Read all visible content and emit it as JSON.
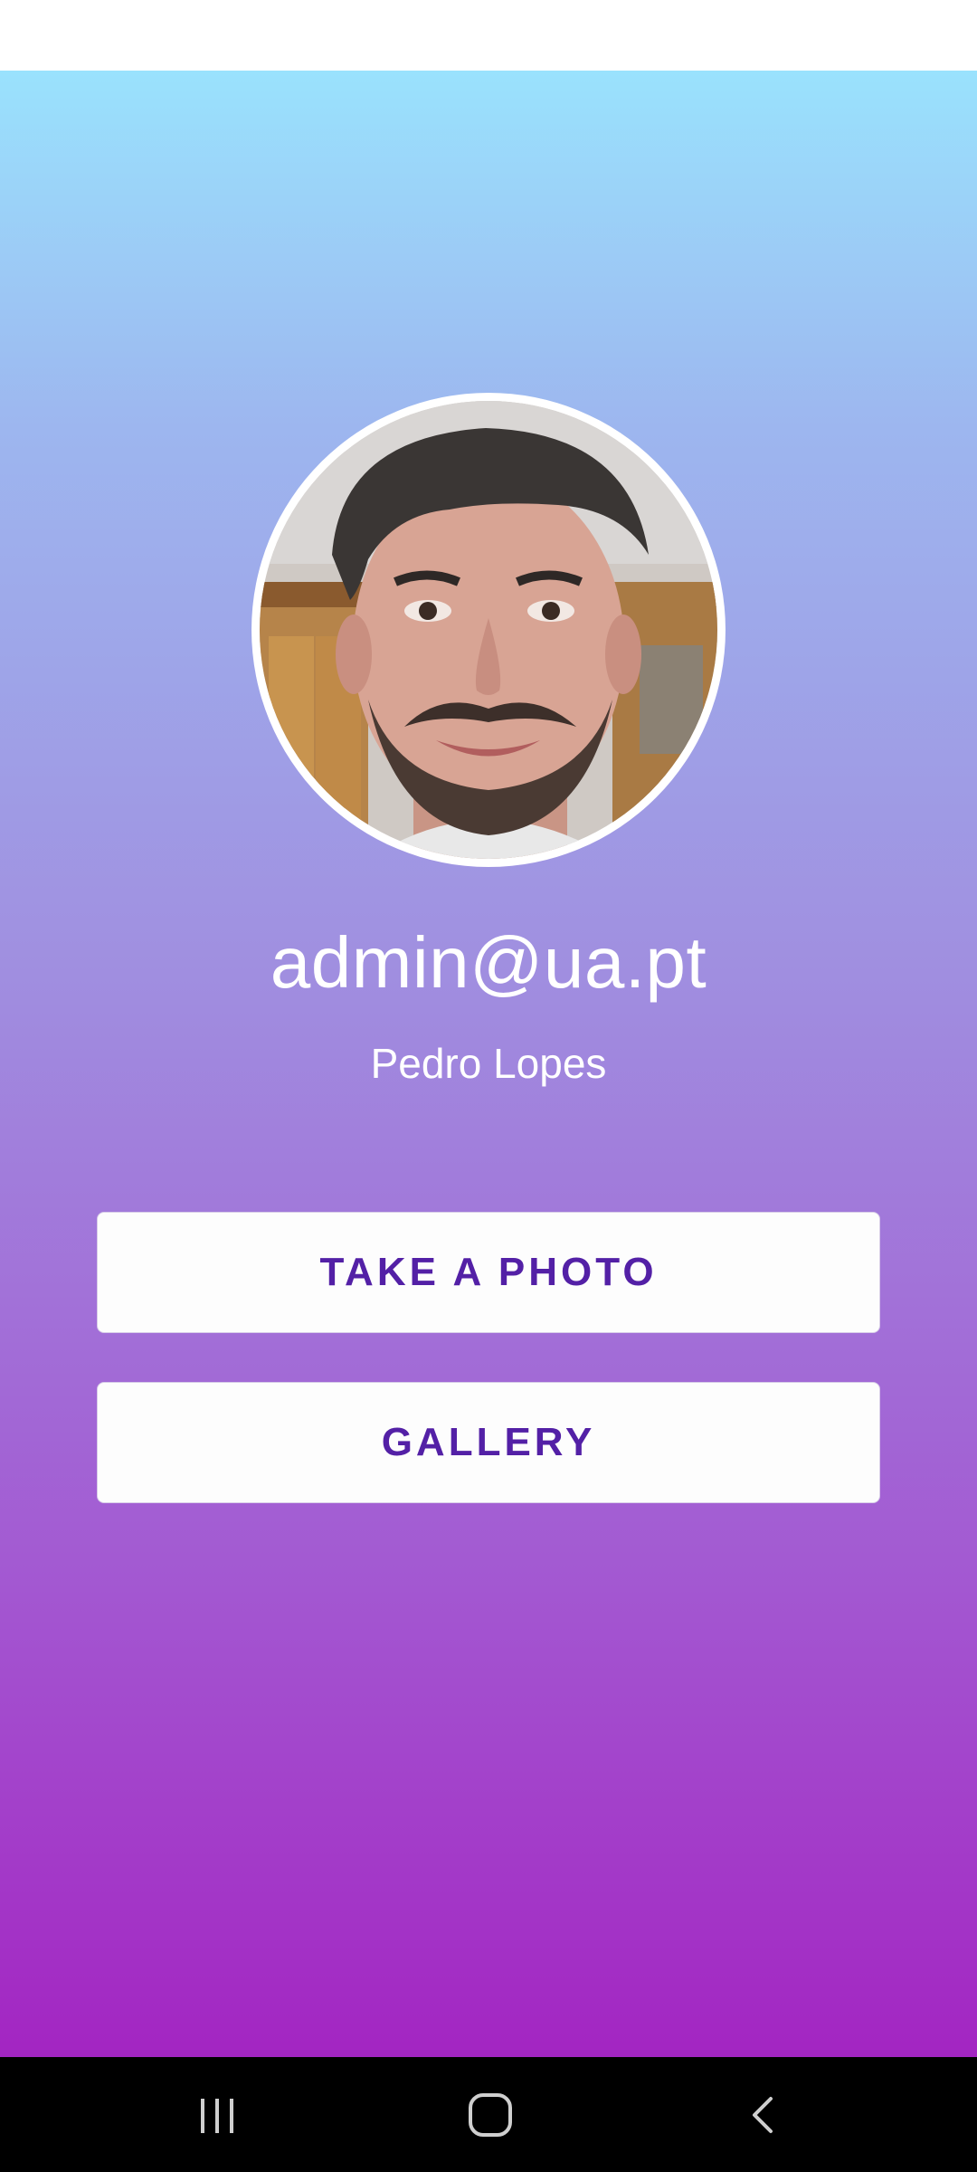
{
  "profile": {
    "email": "admin@ua.pt",
    "name": "Pedro Lopes",
    "avatar_alt": "profile photo"
  },
  "actions": {
    "take_photo_label": "TAKE A PHOTO",
    "gallery_label": "GALLERY"
  },
  "colors": {
    "gradient_top": "#9ae2fd",
    "gradient_bottom": "#a325c2",
    "button_text": "#5320a6",
    "button_bg": "#fdfdfd"
  },
  "nav": {
    "recents_icon": "recents-icon",
    "home_icon": "home-icon",
    "back_icon": "back-icon"
  }
}
